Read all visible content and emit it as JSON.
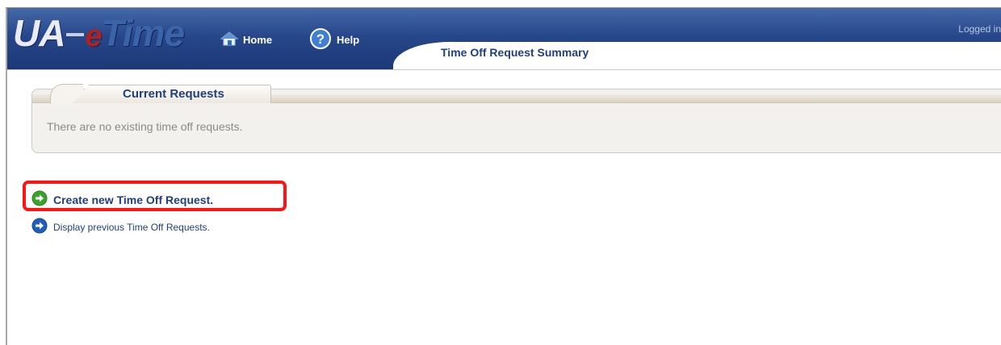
{
  "app": {
    "logo": {
      "ua": "UA",
      "e": "e",
      "time": "Time"
    },
    "nav": {
      "home": "Home",
      "help": "Help"
    },
    "logged_in": "Logged in",
    "page_title": "Time Off Request Summary"
  },
  "current_requests": {
    "tab_label": "Current Requests",
    "empty_message": "There are no existing time off requests."
  },
  "actions": {
    "create": "Create new Time Off Request.",
    "display": "Display previous Time Off Requests."
  },
  "colors": {
    "header_blue": "#27478a",
    "title_text": "#1f3f7f",
    "highlight_red": "#ff1313",
    "green_arrow": "#3aa42a",
    "blue_arrow": "#1f5fb8"
  },
  "icons": [
    "home-icon",
    "help-icon",
    "green-arrow-icon",
    "blue-arrow-icon"
  ]
}
